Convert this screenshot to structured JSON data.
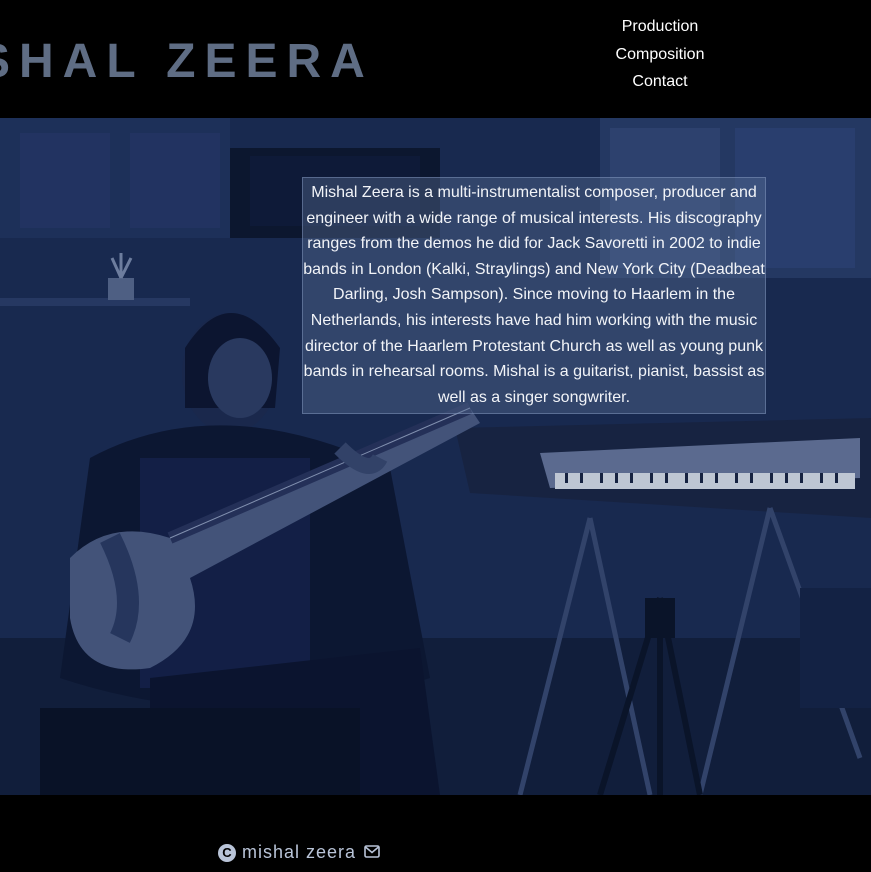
{
  "header": {
    "brand": "SHAL ZEERA"
  },
  "nav": {
    "items": [
      {
        "label": "Production"
      },
      {
        "label": "Composition"
      },
      {
        "label": "Contact"
      }
    ]
  },
  "bio": {
    "text": "Mishal Zeera is a multi-instrumentalist composer, producer and engineer with a wide range of musical interests. His discography ranges from the demos he did for Jack Savoretti in 2002 to indie bands in London (Kalki, Straylings) and New York City (Deadbeat Darling, Josh Sampson). Since moving to Haarlem in the Netherlands, his interests have had him working with the music director of the Haarlem Protestant Church as well as young punk bands in rehearsal rooms. Mishal is a guitarist, pianist, bassist as well as a singer songwriter."
  },
  "footer": {
    "copyright_symbol": "C",
    "name": "mishal zeera"
  },
  "colors": {
    "brand": "#5f6d84",
    "hero_tint": "#1d2f58",
    "footer_text": "#b9c4d8"
  },
  "icons": {
    "copyright": "copyright-icon",
    "mail": "mail-icon"
  }
}
